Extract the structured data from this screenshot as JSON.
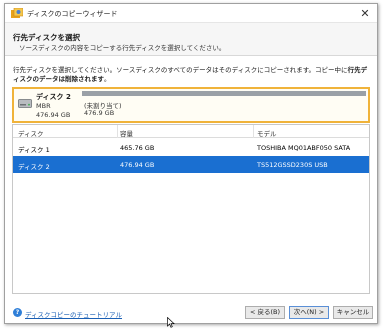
{
  "window": {
    "title": "ディスクのコピーウィザード",
    "close_glyph": "✕"
  },
  "header": {
    "heading": "行先ディスクを選択",
    "subheading": "ソースディスクの内容をコピーする行先ディスクを選択してください。"
  },
  "instruction": {
    "text": "行先ディスクを選択してください。ソースディスクのすべてのデータはそのディスクにコピーされます。コピー中に",
    "bold_text": "行先ディスクのデータは削除されます",
    "end_text": "。"
  },
  "disk_card": {
    "name": "ディスク 2",
    "type": "MBR",
    "size": "476.94 GB",
    "partition_name": "(未割り当て)",
    "partition_size": "476.9 GB"
  },
  "table": {
    "columns": [
      "ディスク",
      "容量",
      "モデル"
    ],
    "rows": [
      {
        "disk": "ディスク 1",
        "capacity": "465.76 GB",
        "model": "TOSHIBA MQ01ABF050 SATA",
        "selected": false
      },
      {
        "disk": "ディスク 2",
        "capacity": "476.94 GB",
        "model": "TS512GSSD230S USB",
        "selected": true
      }
    ]
  },
  "footer": {
    "help_glyph": "?",
    "tutorial_link": "ディスクコピーのチュートリアル",
    "back_label": "< 戻る(B)",
    "next_label": "次へ(N) >",
    "cancel_label": "キャンセル"
  },
  "colors": {
    "selection": "#1a6fd1",
    "disk_card_border": "#f0b33a",
    "link": "#1a5fb4"
  },
  "icons": {
    "app": "wizard-app-icon",
    "disk": "hard-disk-icon",
    "help": "help-circle-icon",
    "close": "close-icon"
  }
}
